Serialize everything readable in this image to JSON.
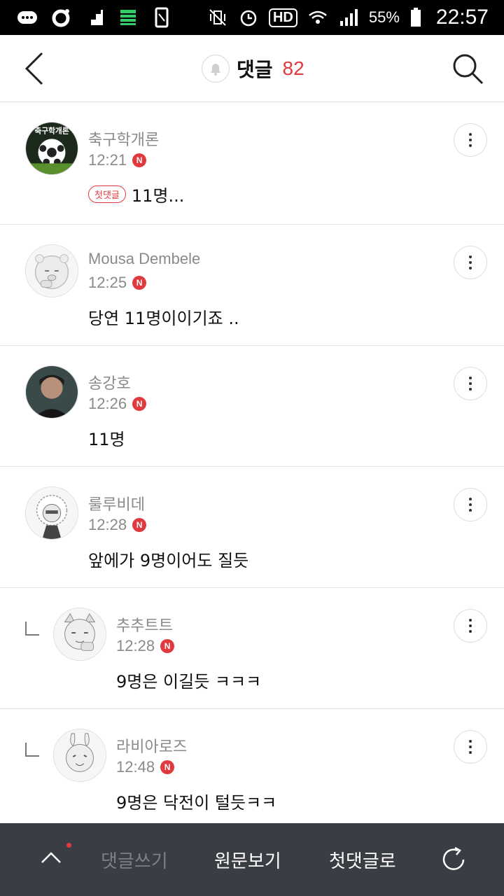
{
  "status_bar": {
    "battery": "55%",
    "time": "22:57",
    "hd_label": "HD"
  },
  "header": {
    "title": "댓글",
    "count": "82"
  },
  "comments": [
    {
      "author": "축구학개론",
      "time": "12:21",
      "badge": "N",
      "tag": "첫댓글",
      "text": "11명...",
      "reply": false
    },
    {
      "author": "Mousa Dembele",
      "time": "12:25",
      "badge": "N",
      "text": "당연 11명이이기죠 ..",
      "reply": false
    },
    {
      "author": "송강호",
      "time": "12:26",
      "badge": "N",
      "text": "11명",
      "reply": false
    },
    {
      "author": "룰루비데",
      "time": "12:28",
      "badge": "N",
      "text": "앞에가 9명이어도 질듯",
      "reply": false
    },
    {
      "author": "추추트트",
      "time": "12:28",
      "badge": "N",
      "text": "9명은 이길듯 ㅋㅋㅋ",
      "reply": true
    },
    {
      "author": "라비아로즈",
      "time": "12:48",
      "badge": "N",
      "text": "9명은 닥전이 털듯ㅋㅋ",
      "reply": true
    }
  ],
  "bottom_bar": {
    "write_label": "댓글쓰기",
    "original_label": "원문보기",
    "first_comment_label": "첫댓글로"
  },
  "colors": {
    "accent": "#e0393e",
    "bottom_bar_bg": "#3b3d44"
  }
}
